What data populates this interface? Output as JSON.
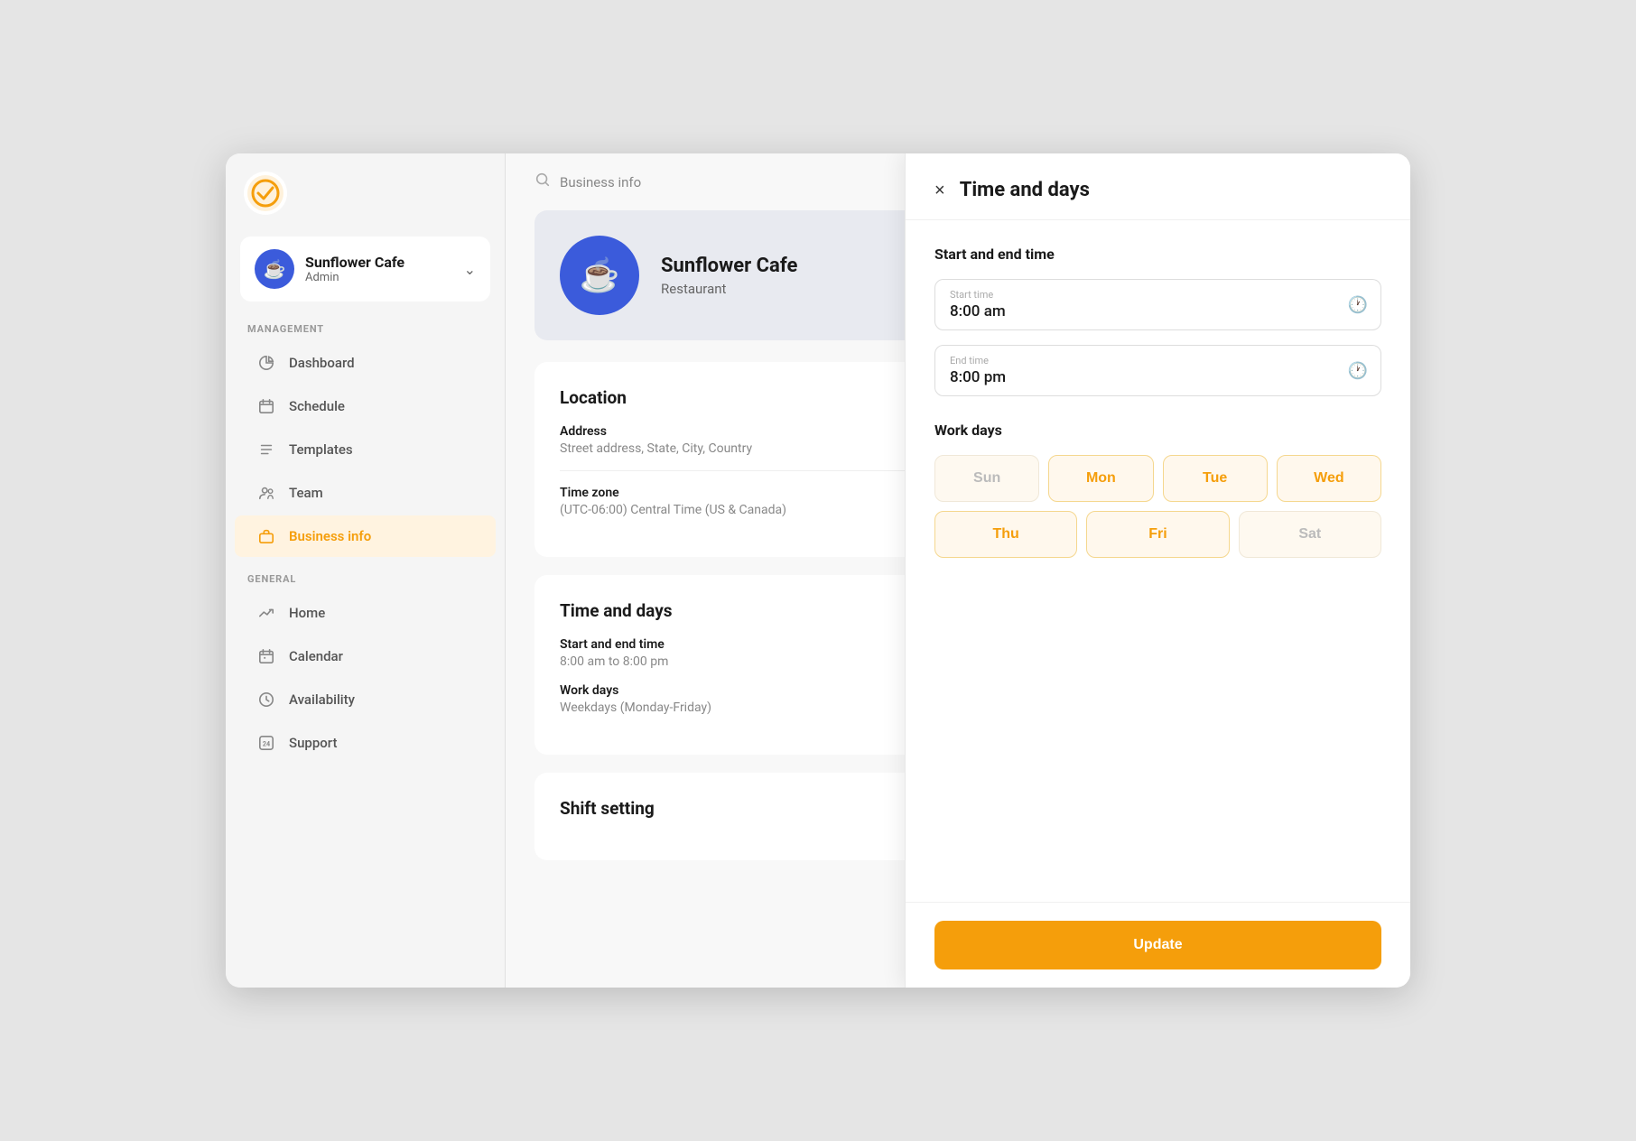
{
  "app": {
    "logo_alt": "QuickShift logo"
  },
  "sidebar": {
    "account": {
      "name": "Sunflower Cafe",
      "role": "Admin"
    },
    "management_label": "MANAGEMENT",
    "management_items": [
      {
        "id": "dashboard",
        "label": "Dashboard",
        "icon": "pie-chart"
      },
      {
        "id": "schedule",
        "label": "Schedule",
        "icon": "calendar"
      },
      {
        "id": "templates",
        "label": "Templates",
        "icon": "list"
      },
      {
        "id": "team",
        "label": "Team",
        "icon": "users"
      },
      {
        "id": "business-info",
        "label": "Business info",
        "icon": "briefcase",
        "active": true
      }
    ],
    "general_label": "GENERAL",
    "general_items": [
      {
        "id": "home",
        "label": "Home",
        "icon": "trending-up"
      },
      {
        "id": "calendar",
        "label": "Calendar",
        "icon": "calendar-day"
      },
      {
        "id": "availability",
        "label": "Availability",
        "icon": "clock"
      },
      {
        "id": "support",
        "label": "Support",
        "icon": "24h"
      }
    ]
  },
  "header": {
    "search_label": "Business info"
  },
  "business": {
    "name": "Sunflower Cafe",
    "type": "Restaurant"
  },
  "location_section": {
    "title": "Location",
    "address_label": "Address",
    "address_value": "Street address, State, City, Country",
    "timezone_label": "Time zone",
    "timezone_value": "(UTC-06:00) Central Time (US & Canada)"
  },
  "time_days_section": {
    "title": "Time and days",
    "start_end_label": "Start and end time",
    "start_end_value": "8:00 am to 8:00 pm",
    "work_days_label": "Work days",
    "work_days_value": "Weekdays (Monday-Friday)"
  },
  "shift_section": {
    "title": "Shift setting"
  },
  "panel": {
    "title": "Time and days",
    "close_label": "×",
    "start_end_section": "Start and end time",
    "start_time_label": "Start time",
    "start_time_value": "8:00 am",
    "end_time_label": "End time",
    "end_time_value": "8:00 pm",
    "work_days_label": "Work days",
    "days": [
      {
        "id": "sun",
        "label": "Sun",
        "active": false
      },
      {
        "id": "mon",
        "label": "Mon",
        "active": true
      },
      {
        "id": "tue",
        "label": "Tue",
        "active": true
      },
      {
        "id": "wed",
        "label": "Wed",
        "active": true
      },
      {
        "id": "thu",
        "label": "Thu",
        "active": true
      },
      {
        "id": "fri",
        "label": "Fri",
        "active": true
      },
      {
        "id": "sat",
        "label": "Sat",
        "active": false
      }
    ],
    "update_label": "Update"
  }
}
